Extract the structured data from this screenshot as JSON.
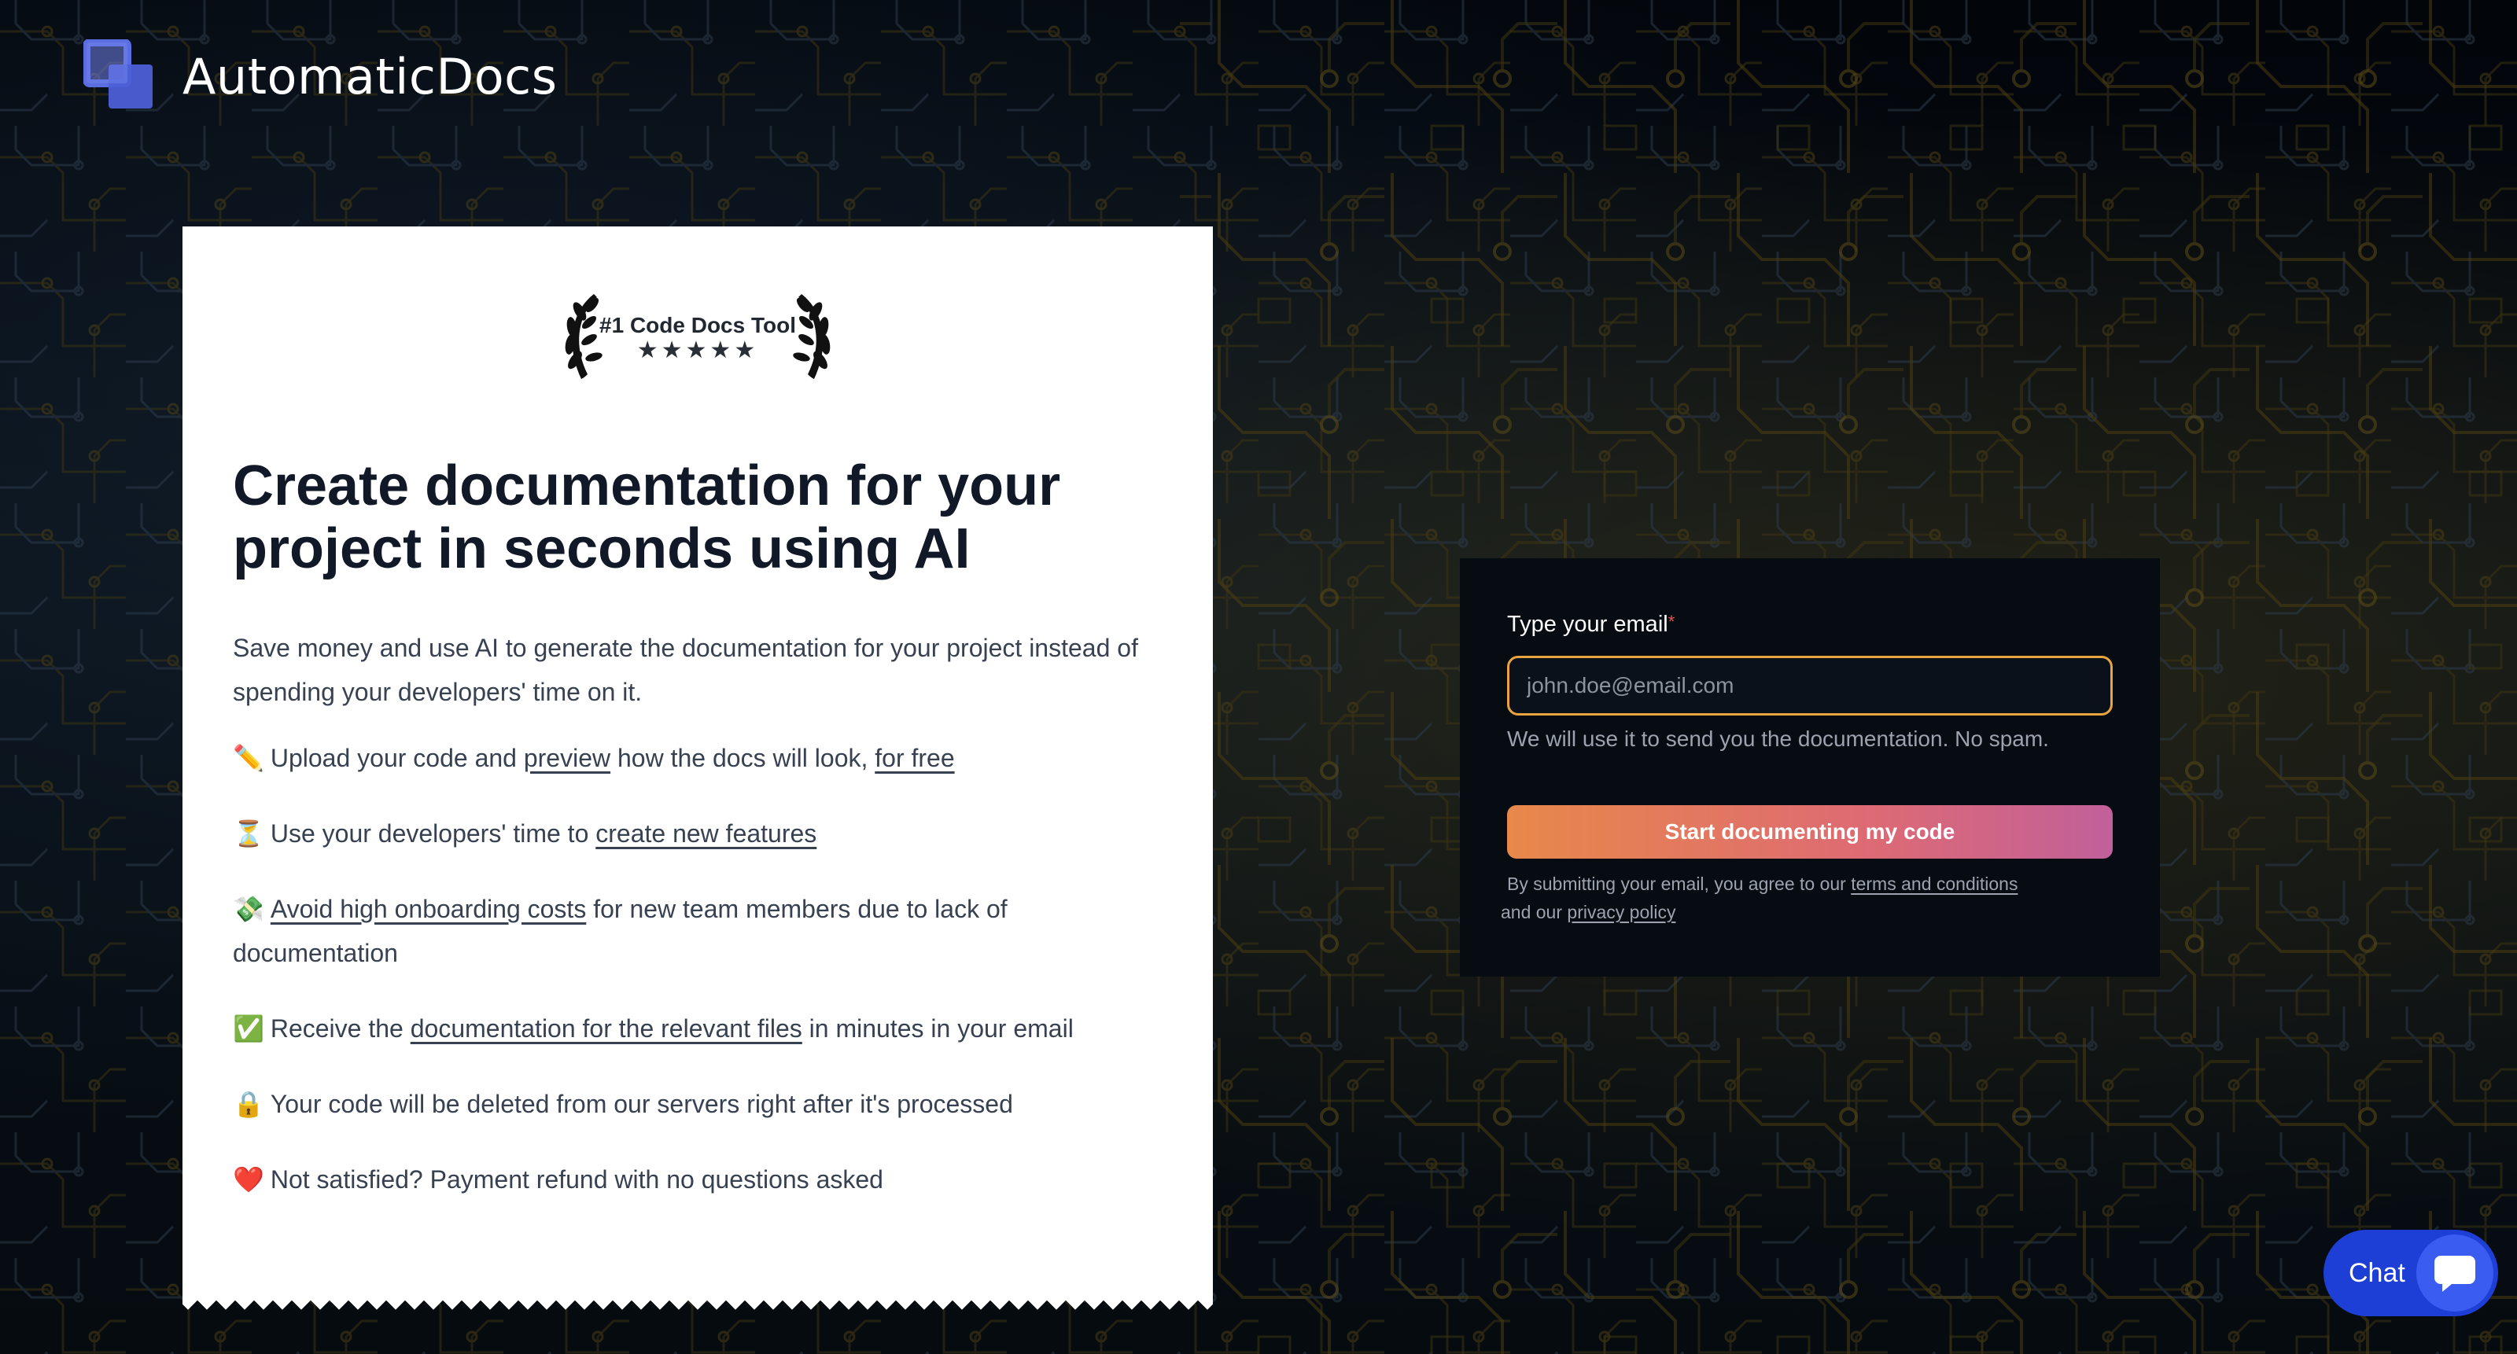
{
  "brand": {
    "name": "AutomaticDocs"
  },
  "badge": {
    "title": "#1 Code Docs Tool",
    "stars": "★★★★★"
  },
  "hero": {
    "headline": "Create documentation for your project in seconds using AI",
    "intro": "Save money and use AI to generate the documentation for your project instead of spending your developers' time on it."
  },
  "bullets": [
    {
      "emoji": "✏️",
      "pre": "Upload your code and ",
      "link1": "preview",
      "mid": " how the docs will look, ",
      "link2": "for free",
      "post": ""
    },
    {
      "emoji": "⏳",
      "pre": "Use your developers' time to ",
      "link1": "create new features",
      "post": ""
    },
    {
      "emoji": "💸",
      "pre": "",
      "link1": "Avoid high onboarding costs",
      "post": " for new team members due to lack of documentation"
    },
    {
      "emoji": "✅",
      "pre": "Receive the ",
      "link1": "documentation for the relevant files",
      "post": " in minutes in your email"
    },
    {
      "emoji": "🔒",
      "pre": "Your code will be deleted from our servers right after it's processed"
    },
    {
      "emoji": "❤️",
      "pre": "Not satisfied? Payment refund with no questions asked"
    }
  ],
  "form": {
    "label": "Type your email",
    "required_mark": "*",
    "placeholder": "john.doe@email.com",
    "value": "",
    "hint": "We will use it to send you the documentation. No spam.",
    "submit_label": "Start documenting my code",
    "legal_pre": "By submitting your email, you agree to our ",
    "terms_link": "terms and conditions",
    "legal_mid": " and our ",
    "privacy_link": "privacy policy"
  },
  "chat": {
    "label": "Chat"
  },
  "colors": {
    "accent_border": "#e9a43f",
    "cta_start": "#e8884a",
    "cta_end": "#c1609a",
    "chat": "#1e3fd6",
    "logo": "#5b6ee1"
  }
}
